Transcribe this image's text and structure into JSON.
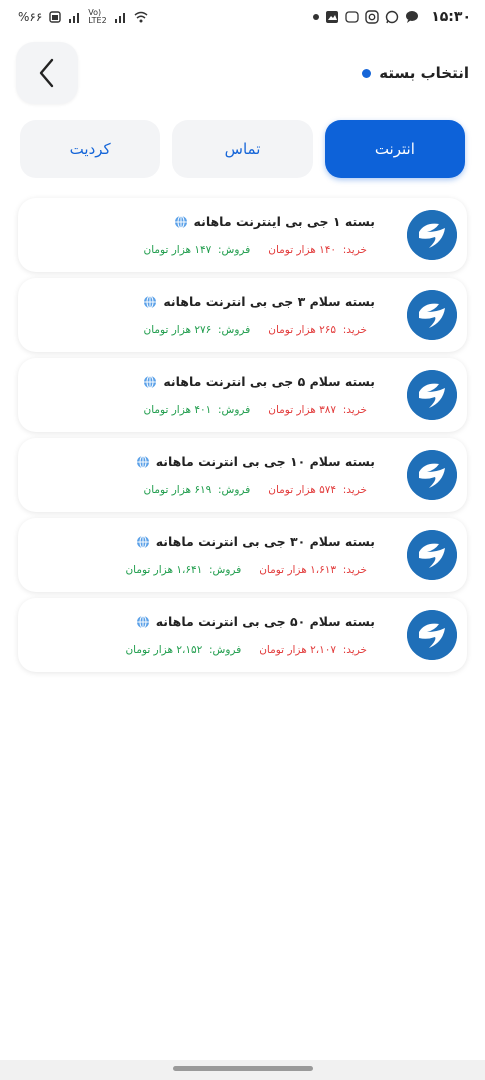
{
  "status_bar": {
    "time": "۱۵:۳۰",
    "battery": "%۶۶",
    "network": "Vo) LTE2"
  },
  "header": {
    "title": "انتخاب بسته"
  },
  "tabs": [
    {
      "label": "انترنت",
      "active": true
    },
    {
      "label": "تماس",
      "active": false
    },
    {
      "label": "کردیت",
      "active": false
    }
  ],
  "labels": {
    "buy": "خرید:",
    "sell": "فروش:"
  },
  "packages": [
    {
      "title": "بسته ۱ جی بی اینترنت ماهانه",
      "buy": "۱۴۰  هزار تومان",
      "sell": "۱۴۷  هزار تومان"
    },
    {
      "title": "بسته سلام  ۳  جی بی انترنت  ماهانه",
      "buy": "۲۶۵  هزار تومان",
      "sell": "۲۷۶  هزار تومان"
    },
    {
      "title": "بسته سلام  ۵  جی بی انترنت  ماهانه",
      "buy": "۳۸۷  هزار تومان",
      "sell": "۴۰۱  هزار تومان"
    },
    {
      "title": "بسته سلام  ۱۰  جی بی انترنت  ماهانه",
      "buy": "۵۷۴  هزار تومان",
      "sell": "۶۱۹  هزار تومان"
    },
    {
      "title": "بسته سلام  ۳۰  جی بی انترنت  ماهانه",
      "buy": "۱،۶۱۳  هزار تومان",
      "sell": "۱،۶۴۱  هزار تومان"
    },
    {
      "title": "بسته سلام  ۵۰  جی بی انترنت  ماهانه",
      "buy": "۲،۱۰۷  هزار تومان",
      "sell": "۲،۱۵۲  هزار تومان"
    }
  ],
  "colors": {
    "accent": "#0d62d9",
    "buy": "#e23b3b",
    "sell": "#1f9d4c"
  }
}
